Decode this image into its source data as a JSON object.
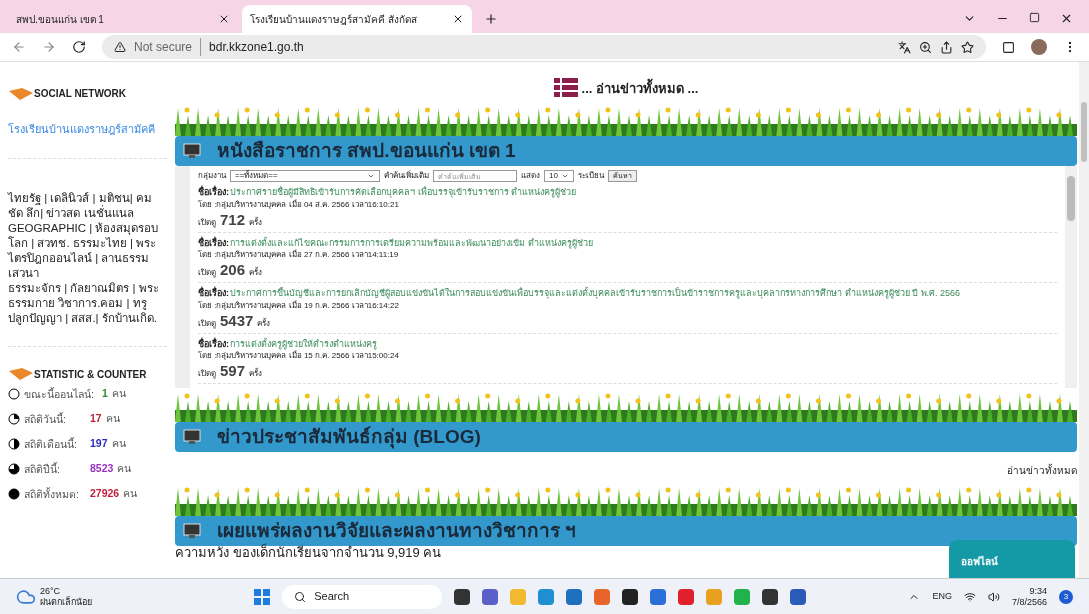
{
  "browser": {
    "tabs": [
      {
        "title": "สพป.ขอนแก่น เขต 1",
        "selected": false
      },
      {
        "title": "โรงเรียนบ้านแดงราษฎร์สามัคคี สังกัดส",
        "selected": true
      }
    ],
    "security": "Not secure",
    "url": "bdr.kkzone1.go.th"
  },
  "sidebar": {
    "social_title": "SOCIAL NETWORK",
    "school_link": "โรงเรียนบ้านแดงราษฎร์สามัคคี",
    "links_text": "ไทยรัฐ | เดลินิวส์ | มติชน| คม ชัด ลึก| ข่าวสด เนชั่นแนล GEOGRAPHIC | ห้องสมุดรอบโลก | สวทช. ธรรมะไทย | พระไตรปิฎกออนไลน์ | ลานธรรมเสวนา",
    "links_text_2": "ธรรมะจักร | กัลยาณมิตร | พระธรรมกาย วิชาการ.คอม | ทรูปลูกปัญญา | สสส.| รักบ้านเกิด.",
    "stats_title": "STATISTIC & COUNTER",
    "stats": [
      {
        "label": "ขณะนี้ออนไลน์:",
        "value": "1",
        "unit": "คน",
        "color": "#2e8b2e"
      },
      {
        "label": "สถิติวันนี้:",
        "value": "17",
        "unit": "คน",
        "color": "#c0203a"
      },
      {
        "label": "สถิติเดือนนี้:",
        "value": "197",
        "unit": "คน",
        "color": "#2b2bc0"
      },
      {
        "label": "สถิติปีนี้:",
        "value": "8523",
        "unit": "คน",
        "color": "#9b30c0"
      },
      {
        "label": "สถิติทั้งหมด:",
        "value": "27926",
        "unit": "คน",
        "color": "#c0203a"
      }
    ]
  },
  "read_all_heading": "... อ่านข่าวทั้งหมด ...",
  "documents": {
    "title": "หนังสือราชการ สพป.ขอนแก่น เขต 1",
    "filter": {
      "group_label": "กลุ่มงาน",
      "group_value": "==ทั้งหมด==",
      "keyword_label": "คำค้นเพิ่มเติม",
      "keyword_placeholder": "คำค้นเพิ่มเติม",
      "show_label": "แสดง",
      "show_value": "10",
      "records_label": "ระเบียน",
      "search_button": "ค้นหา"
    },
    "items": [
      {
        "subject_label": "ชื่อเรื่อง:",
        "subject": "ประกาศรายชื่อผู้มีสิทธิเข้ารับการคัดเลือกบุคคลฯ เพื่อบรรจุเข้ารับราชการ ตำแหน่งครูผู้ช่วย",
        "meta": "โดย :กลุ่มบริหารงานบุคคล เมื่อ 04 ส.ค. 2566 เวลา16:10:21",
        "views_label": "เปิดดู",
        "views": "712",
        "views_unit": "ครั้ง"
      },
      {
        "subject_label": "ชื่อเรื่อง:",
        "subject": "การแต่งตั้งและแก้ไขคณะกรรมการการเตรียมความพร้อมและพัฒนาอย่างเข้ม ตำแหน่งครูผู้ช่วย",
        "meta": "โดย :กลุ่มบริหารงานบุคคล เมื่อ 27 ก.ค. 2566 เวลา14:11:19",
        "views_label": "เปิดดู",
        "views": "206",
        "views_unit": "ครั้ง"
      },
      {
        "subject_label": "ชื่อเรื่อง:",
        "subject": "ประกาศการขึ้นบัญชีและการยกเลิกบัญชีผู้สอบแข่งขันได้ในการสอบแข่งขันเพื่อบรรจุและแต่งตั้งบุคคลเข้ารับราชการเป็นข้าราชการครูและบุคลากรทางการศึกษา ตำแหน่งครูผู้ช่วย ปี พ.ศ. 2566",
        "meta": "โดย :กลุ่มบริหารงานบุคคล เมื่อ 19 ก.ค. 2566 เวลา16:14:22",
        "views_label": "เปิดดู",
        "views": "5437",
        "views_unit": "ครั้ง"
      },
      {
        "subject_label": "ชื่อเรื่อง:",
        "subject": "การแต่งตั้งครูผู้ช่วยให้ดำรงตำแหน่งครู",
        "meta": "โดย :กลุ่มบริหารงานบุคคล เมื่อ 15 ก.ค. 2566 เวลา15:00:24",
        "views_label": "เปิดดู",
        "views": "597",
        "views_unit": "ครั้ง"
      }
    ]
  },
  "blog": {
    "title": "ข่าวประชาสัมพันธ์กลุ่ม (BLOG)",
    "read_all": "อ่านข่าวทั้งหมด"
  },
  "research": {
    "title": "เผยแพร่ผลงานวิจัยและผลงานทางวิชาการ ฯ",
    "first_line": "ความหวัง ของเด็กนักเรียนจากจำนวน 9,919 คน"
  },
  "chat_widget": {
    "status": "ออฟไลน์"
  },
  "taskbar": {
    "temperature": "26°C",
    "weather": "ฝนตกเล็กน้อย",
    "search": "Search",
    "language": "ENG",
    "time": "9:34",
    "date": "7/8/2566",
    "badge": "3"
  }
}
